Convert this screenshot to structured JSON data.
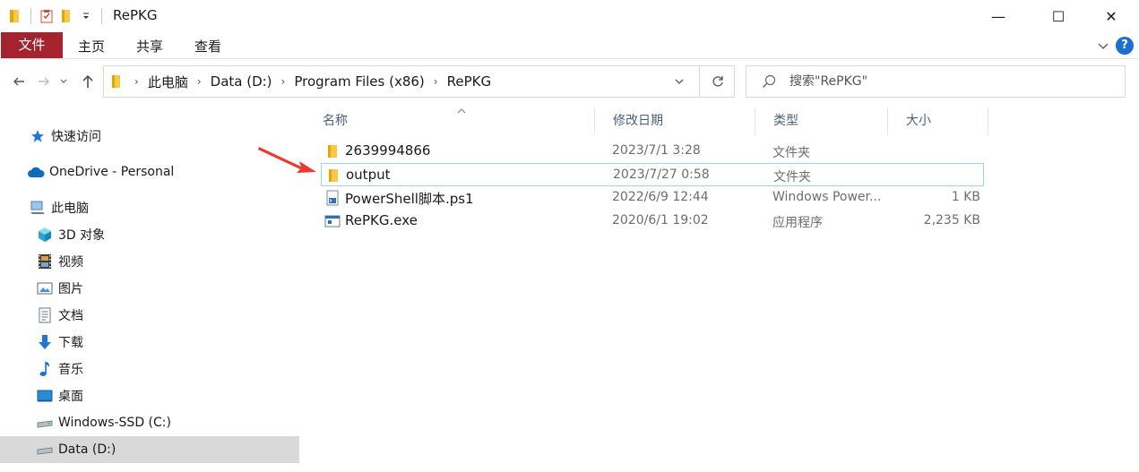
{
  "window": {
    "title": "RePKG",
    "controls": {
      "minimize": "—",
      "maximize": "☐",
      "close": "✕"
    }
  },
  "ribbon": {
    "tabs": [
      {
        "label": "文件",
        "active": true
      },
      {
        "label": "主页"
      },
      {
        "label": "共享"
      },
      {
        "label": "查看"
      }
    ],
    "help_label": "?"
  },
  "colors": {
    "file_tab": "#a4232e",
    "selection_border": "#99d1ff",
    "sidebar_selected": "#d9d9d9",
    "folder_yellow": "#f8c84a",
    "annotation_arrow": "#f0372a"
  },
  "address_bar": {
    "crumbs": [
      "此电脑",
      "Data (D:)",
      "Program Files (x86)",
      "RePKG"
    ]
  },
  "search": {
    "placeholder": "搜索\"RePKG\""
  },
  "sidebar": {
    "items": [
      {
        "label": "快速访问",
        "icon": "star-icon"
      },
      {
        "label": "OneDrive - Personal",
        "icon": "cloud-icon"
      },
      {
        "label": "此电脑",
        "icon": "computer-icon"
      },
      {
        "label": "3D 对象",
        "icon": "cube-icon"
      },
      {
        "label": "视频",
        "icon": "film-icon"
      },
      {
        "label": "图片",
        "icon": "picture-icon"
      },
      {
        "label": "文档",
        "icon": "document-icon"
      },
      {
        "label": "下载",
        "icon": "download-icon"
      },
      {
        "label": "音乐",
        "icon": "music-note-icon"
      },
      {
        "label": "桌面",
        "icon": "desktop-icon"
      },
      {
        "label": "Windows-SSD (C:)",
        "icon": "drive-icon"
      },
      {
        "label": "Data (D:)",
        "icon": "drive-icon",
        "selected": true
      }
    ]
  },
  "file_list": {
    "columns": {
      "name": "名称",
      "date": "修改日期",
      "type": "类型",
      "size": "大小"
    },
    "rows": [
      {
        "name": "2639994866",
        "date": "2023/7/1 3:28",
        "type": "文件夹",
        "size": "",
        "icon": "folder-icon"
      },
      {
        "name": "output",
        "date": "2023/7/27 0:58",
        "type": "文件夹",
        "size": "",
        "icon": "folder-icon",
        "selected": true
      },
      {
        "name": "PowerShell脚本.ps1",
        "date": "2022/6/9 12:44",
        "type": "Windows Power...",
        "size": "1 KB",
        "icon": "powershell-script-icon"
      },
      {
        "name": "RePKG.exe",
        "date": "2020/6/1 19:02",
        "type": "应用程序",
        "size": "2,235 KB",
        "icon": "exe-icon"
      }
    ]
  }
}
